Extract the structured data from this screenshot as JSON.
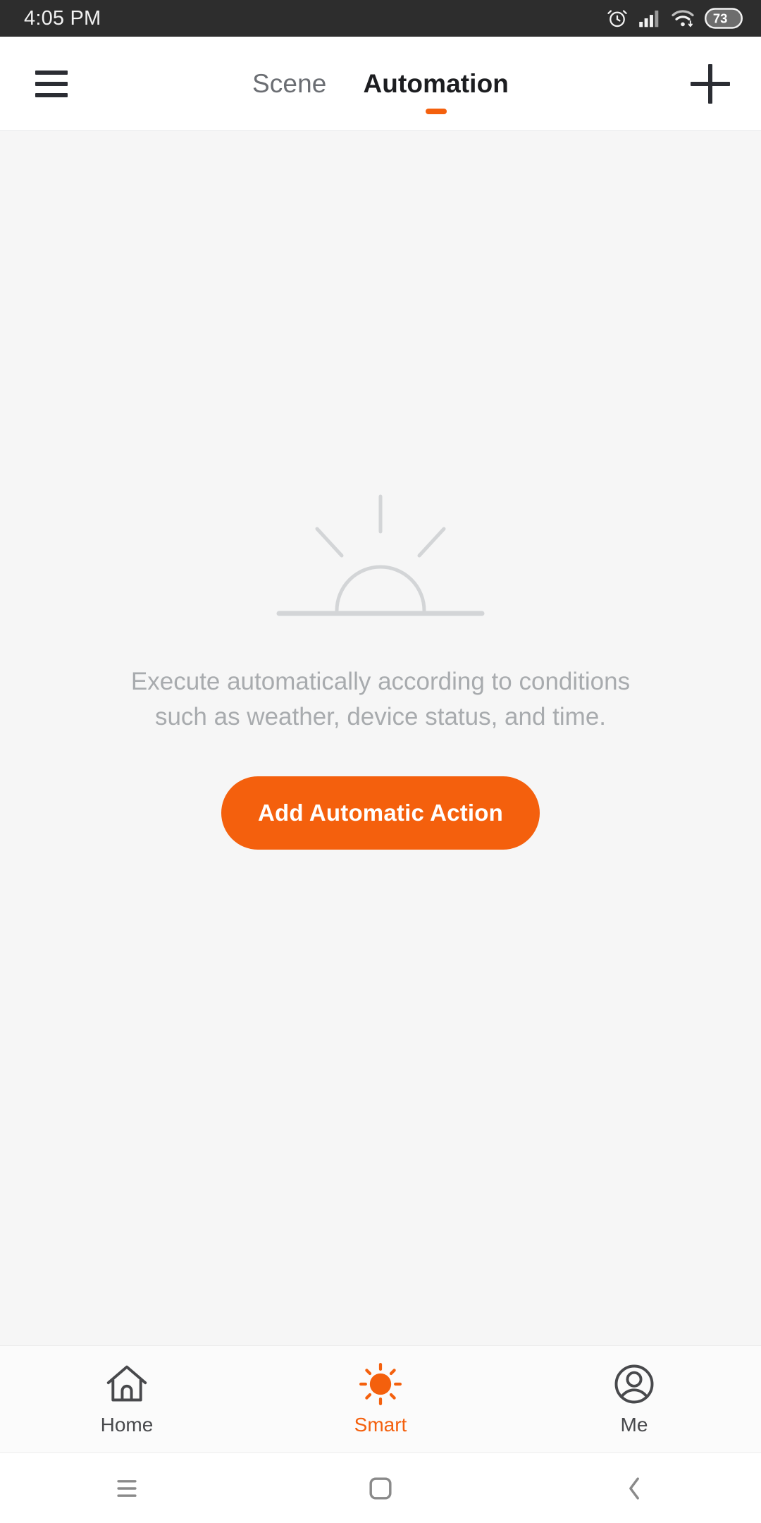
{
  "status_bar": {
    "time": "4:05 PM",
    "battery_level": "73",
    "icons": [
      "alarm-clock-icon",
      "cellular-signal-icon",
      "wifi-icon",
      "battery-icon"
    ]
  },
  "header": {
    "menu_icon": "hamburger-menu-icon",
    "add_icon": "plus-icon",
    "tabs": [
      {
        "label": "Scene",
        "active": false
      },
      {
        "label": "Automation",
        "active": true
      }
    ]
  },
  "main": {
    "illustration_icon": "sunrise-icon",
    "empty_message": "Execute automatically according to conditions such as weather, device status, and time.",
    "cta_label": "Add Automatic Action"
  },
  "bottom_nav": {
    "items": [
      {
        "label": "Home",
        "icon": "house-icon",
        "active": false
      },
      {
        "label": "Smart",
        "icon": "sun-icon",
        "active": true
      },
      {
        "label": "Me",
        "icon": "person-icon",
        "active": false
      }
    ]
  },
  "system_nav": {
    "keys": [
      {
        "name": "recents-key",
        "icon": "menu-lines-icon"
      },
      {
        "name": "home-key",
        "icon": "rounded-square-icon"
      },
      {
        "name": "back-key",
        "icon": "chevron-left-icon"
      }
    ]
  },
  "colors": {
    "accent": "#f4600d",
    "status_bar_bg": "#2d2d2d",
    "content_bg": "#f6f6f6",
    "muted_text": "#a8abae"
  }
}
